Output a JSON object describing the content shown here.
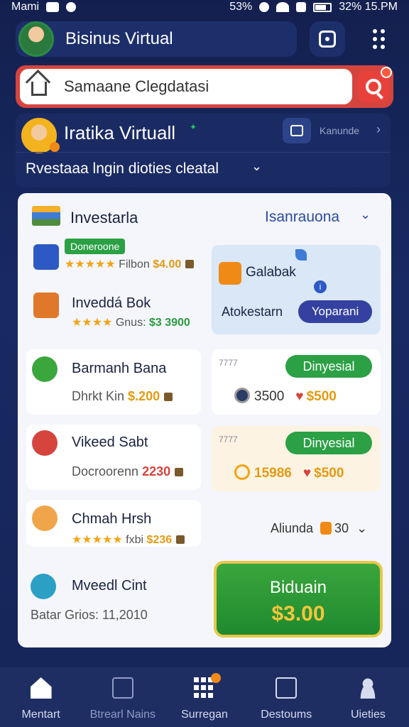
{
  "status_bar": {
    "carrier": "Mami",
    "battery_text": "53%",
    "right_text": "32% 15.PM"
  },
  "header": {
    "title": "Bisinus Virtual"
  },
  "search": {
    "placeholder": "Samaane Clegdatasi"
  },
  "profile": {
    "name": "Iratika Virtuall",
    "link": "Kanunde",
    "subtitle": "Rvestaaa lngin dioties cleatal"
  },
  "panel": {
    "title": "Investarla",
    "filter": "Isanrauona"
  },
  "items": [
    {
      "tag": "Doneroone",
      "stars": "★★★★★",
      "label": "Filbon",
      "price": "$4.00"
    },
    {
      "title": "Inveddá Bok",
      "stars": "★★★★",
      "label": "Gnus:",
      "price": "$3 3900"
    },
    {
      "title": "Barmanh Bana",
      "label": "Dhrkt Kin",
      "price": "$.200"
    },
    {
      "title": "Vikeed Sabt",
      "label": "Docroorenn",
      "price": "2230"
    },
    {
      "title": "Chmah Hrsh",
      "stars": "★★★★★",
      "label": "fxbi",
      "price": "$236"
    },
    {
      "title": "Mveedl Cint",
      "label": "Batar Grios:",
      "price": "11,2010"
    }
  ],
  "promo": {
    "title": "Galabak",
    "info": "i",
    "text": "Atokestarn",
    "button": "Yoparani"
  },
  "offers": [
    {
      "tiny": "7777",
      "badge": "Dinyesial",
      "value": "3500",
      "price": "$500"
    },
    {
      "tiny": "7777",
      "badge": "Dinyesial",
      "value": "15986",
      "price": "$500"
    }
  ],
  "filter_row": {
    "label": "Aliunda",
    "value": "30"
  },
  "buy": {
    "label": "Biduain",
    "price": "$3.00"
  },
  "bottom_nav": [
    {
      "label": "Mentart"
    },
    {
      "label": "Btrearl Nains"
    },
    {
      "label": "Surregan"
    },
    {
      "label": "Destoums"
    },
    {
      "label": "Uieties"
    }
  ],
  "colors": {
    "accent_red": "#d6443e",
    "accent_green": "#2ba045",
    "gold": "#f5c53b",
    "navy": "#182a63"
  }
}
